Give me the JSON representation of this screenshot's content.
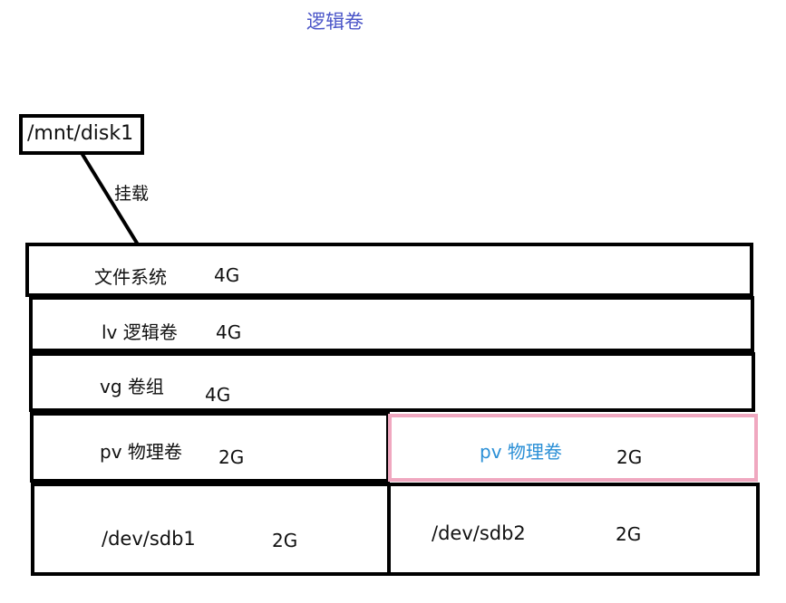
{
  "title": "逻辑卷",
  "mount": {
    "path": "/mnt/disk1",
    "edge_label": "挂载"
  },
  "layers": {
    "filesystem": {
      "label": "文件系统",
      "size": "4G"
    },
    "lv": {
      "label": "lv 逻辑卷",
      "size": "4G"
    },
    "vg": {
      "label": "vg 卷组",
      "size": "4G"
    },
    "pv1": {
      "label": "pv 物理卷",
      "size": "2G"
    },
    "pv2": {
      "label": "pv 物理卷",
      "size": "2G"
    },
    "dev1": {
      "label": "/dev/sdb1",
      "size": "2G"
    },
    "dev2": {
      "label": "/dev/sdb2",
      "size": "2G"
    }
  },
  "colors": {
    "title": "#4a55c8",
    "pv2_label": "#2a8fd6",
    "pv2_border": "#f0a8c0",
    "border": "#000000"
  }
}
